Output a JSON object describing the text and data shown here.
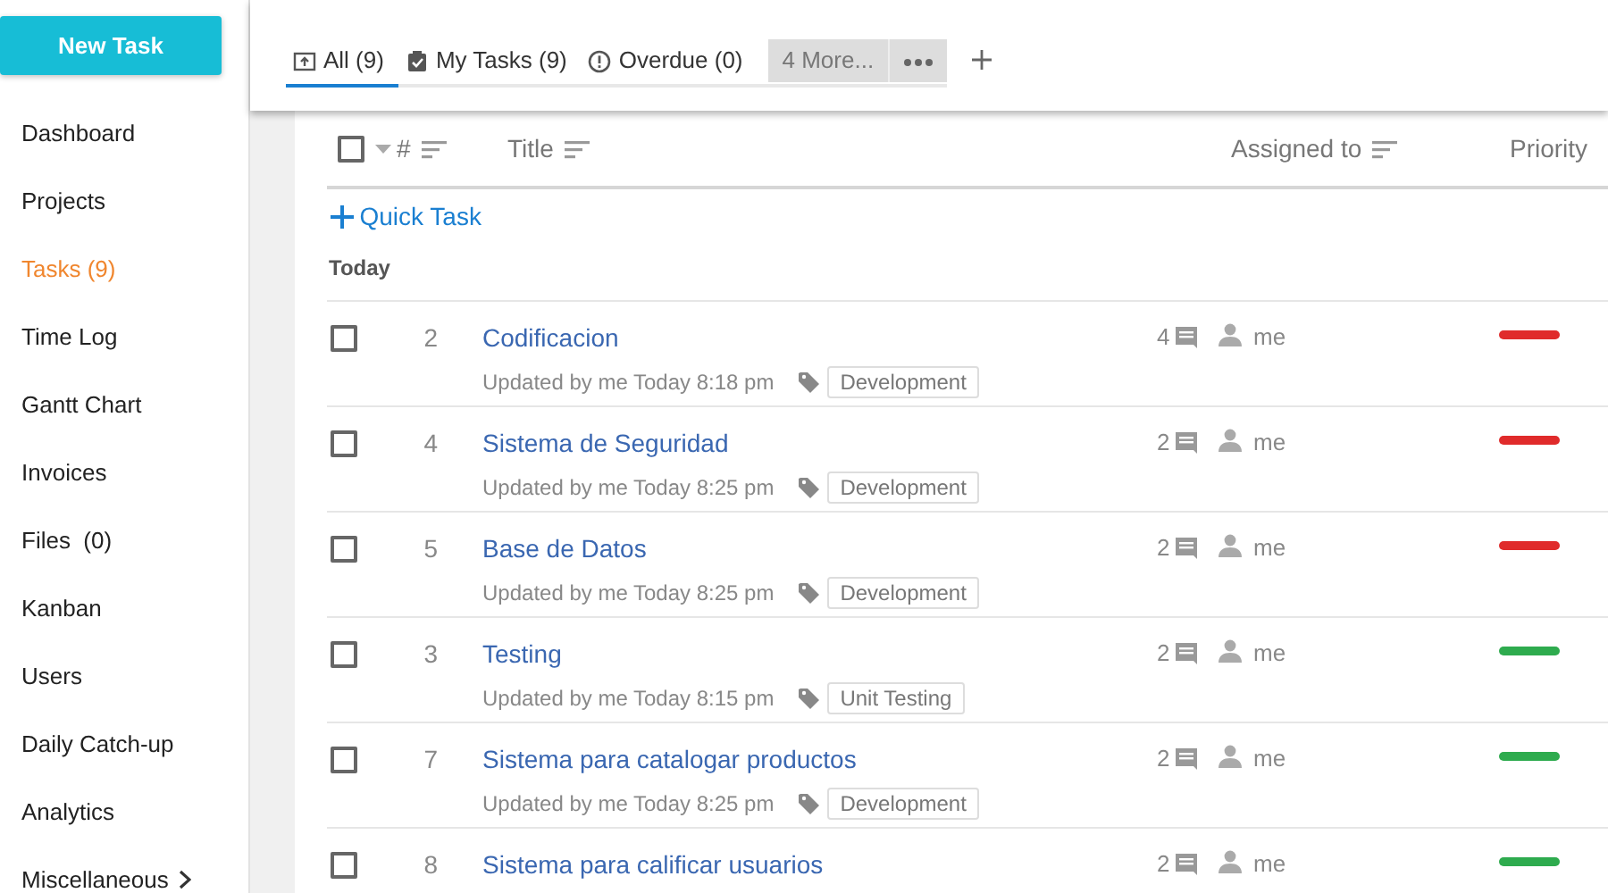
{
  "new_task_button": "New Task",
  "sidebar": {
    "items": [
      {
        "label": "Dashboard",
        "selected": false
      },
      {
        "label": "Projects",
        "selected": false
      },
      {
        "label": "Tasks (9)",
        "selected": true
      },
      {
        "label": "Time Log",
        "selected": false
      },
      {
        "label": "Gantt Chart",
        "selected": false
      },
      {
        "label": "Invoices",
        "selected": false
      },
      {
        "label": "Files  (0)",
        "selected": false
      },
      {
        "label": "Kanban",
        "selected": false
      },
      {
        "label": "Users",
        "selected": false
      },
      {
        "label": "Daily Catch-up",
        "selected": false
      },
      {
        "label": "Analytics",
        "selected": false
      },
      {
        "label": "Miscellaneous",
        "selected": false,
        "submenu": true
      }
    ]
  },
  "tabs": [
    {
      "label": "All (9)",
      "selected": true
    },
    {
      "label": "My Tasks (9)",
      "selected": false
    },
    {
      "label": "Overdue (0)",
      "selected": false
    }
  ],
  "more_tabs": "4 More...",
  "table": {
    "select_all_checked": false,
    "columns": [
      "#",
      "Title",
      "Assigned to",
      "Priority"
    ],
    "quick_task": "Quick Task",
    "group": "Today",
    "rows": [
      {
        "checked": false,
        "number": "2",
        "title": "Codificacion",
        "meta": "Updated by me Today 8:18 pm",
        "tag": "Development",
        "comments": "4",
        "assignee": "me",
        "color": "#e02b2b"
      },
      {
        "checked": false,
        "number": "4",
        "title": "Sistema de Seguridad",
        "meta": "Updated by me Today 8:25 pm",
        "tag": "Development",
        "comments": "2",
        "assignee": "me",
        "color": "#e02b2b"
      },
      {
        "checked": false,
        "number": "5",
        "title": "Base de Datos",
        "meta": "Updated by me Today 8:25 pm",
        "tag": "Development",
        "comments": "2",
        "assignee": "me",
        "color": "#e02b2b"
      },
      {
        "checked": false,
        "number": "3",
        "title": "Testing",
        "meta": "Updated by me Today 8:15 pm",
        "tag": "Unit Testing",
        "comments": "2",
        "assignee": "me",
        "color": "#2eab4e"
      },
      {
        "checked": false,
        "number": "7",
        "title": "Sistema para catalogar productos",
        "meta": "Updated by me Today 8:25 pm",
        "tag": "Development",
        "comments": "2",
        "assignee": "me",
        "color": "#2eab4e"
      },
      {
        "checked": false,
        "number": "8",
        "title": "Sistema para calificar usuarios",
        "comments": "2",
        "assignee": "me",
        "color": "#2eab4e"
      }
    ]
  }
}
